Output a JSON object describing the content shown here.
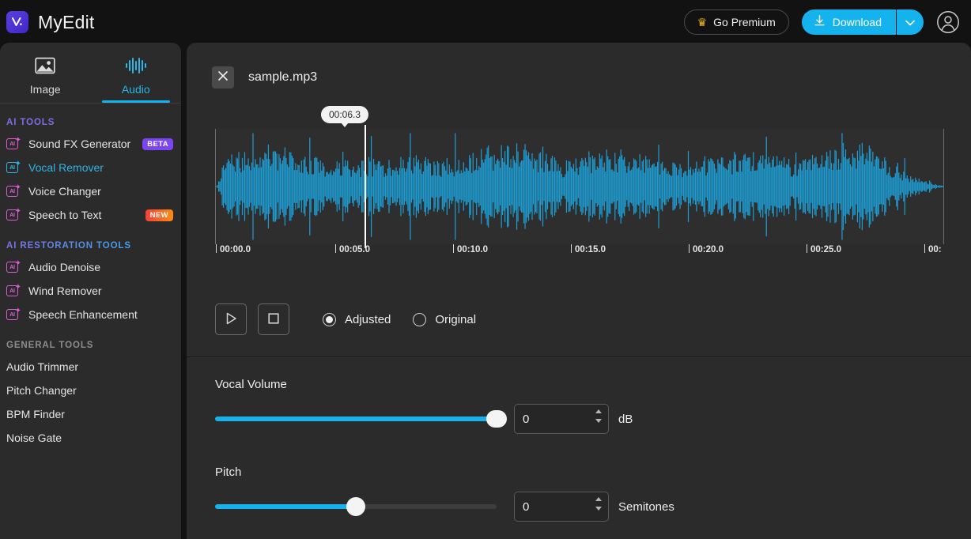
{
  "app": {
    "name": "MyEdit",
    "logo_icon": "myedit-logo-icon"
  },
  "topbar": {
    "premium_label": "Go Premium",
    "premium_icon": "crown-icon",
    "download_label": "Download",
    "download_icon": "download-icon",
    "download_caret_icon": "chevron-down-icon",
    "account_icon": "account-circle-icon",
    "accent_color": "#15b3ee"
  },
  "sidebar": {
    "tabs": [
      {
        "label": "Image",
        "icon": "image-icon",
        "active": false
      },
      {
        "label": "Audio",
        "icon": "audio-waveform-icon",
        "active": true
      }
    ],
    "sections": [
      {
        "heading": "AI TOOLS",
        "items": [
          {
            "label": "Sound FX Generator",
            "icon": "ai-sparkle-icon",
            "badge": "BETA",
            "active": false
          },
          {
            "label": "Vocal Remover",
            "icon": "ai-sparkle-icon",
            "badge": "",
            "active": true
          },
          {
            "label": "Voice Changer",
            "icon": "ai-sparkle-icon",
            "badge": "",
            "active": false
          },
          {
            "label": "Speech to Text",
            "icon": "ai-sparkle-icon",
            "badge": "NEW",
            "active": false
          }
        ]
      },
      {
        "heading": "AI RESTORATION TOOLS",
        "items": [
          {
            "label": "Audio Denoise",
            "icon": "ai-sparkle-icon",
            "badge": "",
            "active": false
          },
          {
            "label": "Wind Remover",
            "icon": "ai-sparkle-icon",
            "badge": "",
            "active": false
          },
          {
            "label": "Speech Enhancement",
            "icon": "ai-sparkle-icon",
            "badge": "",
            "active": false
          }
        ]
      },
      {
        "heading": "GENERAL TOOLS",
        "items": [
          {
            "label": "Audio Trimmer",
            "icon": "",
            "badge": "",
            "active": false
          },
          {
            "label": "Pitch Changer",
            "icon": "",
            "badge": "",
            "active": false
          },
          {
            "label": "BPM Finder",
            "icon": "",
            "badge": "",
            "active": false
          },
          {
            "label": "Noise Gate",
            "icon": "",
            "badge": "",
            "active": false
          }
        ]
      }
    ]
  },
  "main": {
    "file": {
      "name": "sample.mp3",
      "close_icon": "close-x-icon"
    },
    "waveform": {
      "playhead_time": "00:06.3",
      "wave_color": "#1e9bd0",
      "ticks": [
        {
          "label": "00:00.0"
        },
        {
          "label": "00:05.0"
        },
        {
          "label": "00:10.0"
        },
        {
          "label": "00:15.0"
        },
        {
          "label": "00:20.0"
        },
        {
          "label": "00:25.0"
        },
        {
          "label": "00:"
        }
      ]
    },
    "controls": {
      "play_icon": "play-icon",
      "stop_icon": "stop-icon",
      "modes": [
        {
          "label": "Adjusted",
          "selected": true
        },
        {
          "label": "Original",
          "selected": false
        }
      ]
    },
    "sliders": [
      {
        "label": "Vocal Volume",
        "value": "0",
        "unit": "dB",
        "fill_percent": 100,
        "thumb_percent": 100
      },
      {
        "label": "Pitch",
        "value": "0",
        "unit": "Semitones",
        "fill_percent": 50,
        "thumb_percent": 50
      }
    ]
  }
}
